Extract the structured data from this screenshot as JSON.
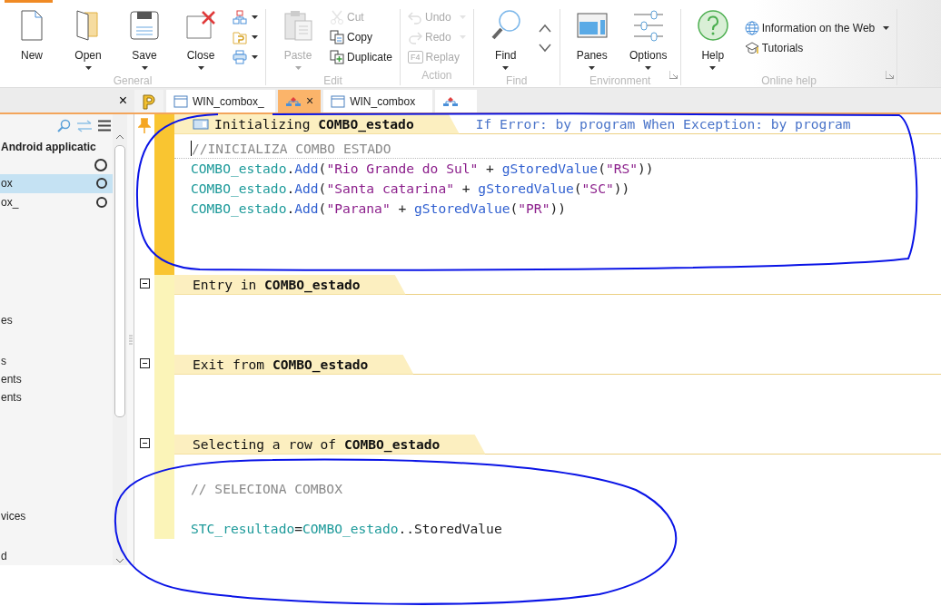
{
  "ribbon": {
    "groups": [
      {
        "label": "General",
        "launcher": false,
        "columns": [
          {
            "kind": "large",
            "buttons": [
              {
                "label": "New",
                "dropdown": false,
                "disabled": false
              }
            ]
          },
          {
            "kind": "large",
            "buttons": [
              {
                "label": "Open",
                "dropdown": true,
                "disabled": false
              }
            ]
          },
          {
            "kind": "large",
            "buttons": [
              {
                "label": "Save",
                "dropdown": true,
                "disabled": false
              }
            ]
          },
          {
            "kind": "large",
            "buttons": [
              {
                "label": "Close",
                "dropdown": true,
                "disabled": false
              }
            ]
          },
          {
            "kind": "stack",
            "buttons": [
              {
                "dropdown": true,
                "disabled": false
              },
              {
                "dropdown": true,
                "disabled": false
              },
              {
                "dropdown": true,
                "disabled": false
              }
            ]
          }
        ]
      },
      {
        "label": "Edit",
        "launcher": false,
        "columns": [
          {
            "kind": "large",
            "buttons": [
              {
                "label": "Paste",
                "dropdown": true,
                "disabled": true
              }
            ]
          },
          {
            "kind": "stack",
            "buttons": [
              {
                "label": "Cut",
                "dropdown": false,
                "disabled": true
              },
              {
                "label": "Copy",
                "dropdown": false,
                "disabled": false
              },
              {
                "label": "Duplicate",
                "dropdown": false,
                "disabled": false
              }
            ]
          }
        ]
      },
      {
        "label": "Action",
        "launcher": false,
        "columns": [
          {
            "kind": "stack",
            "buttons": [
              {
                "label": "Undo",
                "dropdown": true,
                "disabled": true
              },
              {
                "label": "Redo",
                "dropdown": true,
                "disabled": true
              },
              {
                "label": "Replay",
                "key": "F4",
                "dropdown": false,
                "disabled": true
              }
            ]
          }
        ]
      },
      {
        "label": "Find",
        "launcher": false,
        "columns": [
          {
            "kind": "large",
            "buttons": [
              {
                "label": "Find",
                "dropdown": true,
                "disabled": false
              }
            ]
          },
          {
            "kind": "stack",
            "buttons": [
              {
                "dropdown": false,
                "disabled": false
              },
              {
                "dropdown": false,
                "disabled": false
              }
            ]
          }
        ]
      },
      {
        "label": "Environment",
        "launcher": true,
        "columns": [
          {
            "kind": "large",
            "buttons": [
              {
                "label": "Panes",
                "dropdown": true,
                "disabled": false
              }
            ]
          },
          {
            "kind": "large",
            "buttons": [
              {
                "label": "Options",
                "dropdown": true,
                "disabled": false
              }
            ]
          }
        ]
      },
      {
        "label": "Online help",
        "launcher": true,
        "columns": [
          {
            "kind": "large",
            "buttons": [
              {
                "label": "Help",
                "dropdown": true,
                "disabled": false
              }
            ]
          },
          {
            "kind": "stack",
            "buttons": [
              {
                "label": "Information on the Web",
                "dropdown": true,
                "disabled": false
              },
              {
                "label": "Tutorials",
                "dropdown": false,
                "disabled": false
              }
            ]
          }
        ]
      }
    ]
  },
  "left_panel": {
    "close": "×",
    "items": [
      {
        "kind": "heading",
        "label": "Android applicatic",
        "selected": false
      },
      {
        "kind": "entry",
        "selected": false,
        "ring": true
      },
      {
        "kind": "entry",
        "label": "ox",
        "selected": true,
        "ring": true
      },
      {
        "kind": "entry",
        "label": "ox_",
        "selected": false,
        "ring": true
      },
      {
        "kind": "spacer"
      },
      {
        "kind": "entry",
        "label": "es",
        "selected": false,
        "ring": false
      },
      {
        "kind": "gap"
      },
      {
        "kind": "entry",
        "label": "s",
        "selected": false,
        "ring": false
      },
      {
        "kind": "entry",
        "label": "ents",
        "selected": false,
        "ring": false
      },
      {
        "kind": "entry",
        "label": "ents",
        "selected": false,
        "ring": false
      },
      {
        "kind": "spacer"
      },
      {
        "kind": "entry",
        "label": "vices",
        "selected": false,
        "ring": false
      },
      {
        "kind": "gap"
      },
      {
        "kind": "entry",
        "label": "d",
        "selected": false,
        "ring": false
      }
    ]
  },
  "tabs": [
    {
      "kind": "project",
      "selected": false
    },
    {
      "kind": "window",
      "label": "WIN_combox_",
      "selected": false
    },
    {
      "kind": "code",
      "selected": true,
      "close": "×"
    },
    {
      "kind": "window",
      "label": "WIN_combox",
      "selected": false
    },
    {
      "kind": "code",
      "selected": false
    }
  ],
  "sections": [
    {
      "title": "Initializing **COMBO_estado**",
      "note": "If Error: by program When Exception: by program",
      "active": true,
      "lines": [
        {
          "kind": "code",
          "cursor": true,
          "tokens": [
            {
              "kind": "comment",
              "text": "//INICIALIZA COMBO ESTADO"
            }
          ]
        },
        {
          "kind": "code",
          "cursor": false,
          "tokens": [
            {
              "kind": "ident",
              "text": "COMBO_estado"
            },
            {
              "kind": "plain",
              "text": "."
            },
            {
              "kind": "func",
              "text": "Add"
            },
            {
              "kind": "plain",
              "text": "("
            },
            {
              "kind": "string",
              "text": "\"Rio Grande do Sul\""
            },
            {
              "kind": "plain",
              "text": " + "
            },
            {
              "kind": "func",
              "text": "gStoredValue"
            },
            {
              "kind": "plain",
              "text": "("
            },
            {
              "kind": "string",
              "text": "\"RS\""
            },
            {
              "kind": "plain",
              "text": "))"
            }
          ]
        },
        {
          "kind": "code",
          "cursor": false,
          "tokens": [
            {
              "kind": "ident",
              "text": "COMBO_estado"
            },
            {
              "kind": "plain",
              "text": "."
            },
            {
              "kind": "func",
              "text": "Add"
            },
            {
              "kind": "plain",
              "text": "("
            },
            {
              "kind": "string",
              "text": "\"Santa catarina\""
            },
            {
              "kind": "plain",
              "text": " + "
            },
            {
              "kind": "func",
              "text": "gStoredValue"
            },
            {
              "kind": "plain",
              "text": "("
            },
            {
              "kind": "string",
              "text": "\"SC\""
            },
            {
              "kind": "plain",
              "text": "))"
            }
          ]
        },
        {
          "kind": "code",
          "cursor": false,
          "tokens": [
            {
              "kind": "ident",
              "text": "COMBO_estado"
            },
            {
              "kind": "plain",
              "text": "."
            },
            {
              "kind": "func",
              "text": "Add"
            },
            {
              "kind": "plain",
              "text": "("
            },
            {
              "kind": "string",
              "text": "\"Parana\""
            },
            {
              "kind": "plain",
              "text": " + "
            },
            {
              "kind": "func",
              "text": "gStoredValue"
            },
            {
              "kind": "plain",
              "text": "("
            },
            {
              "kind": "string",
              "text": "\"PR\""
            },
            {
              "kind": "plain",
              "text": "))"
            }
          ]
        }
      ]
    },
    {
      "title": "Entry in **COMBO_estado**",
      "active": false
    },
    {
      "title": "Exit from **COMBO_estado**",
      "active": false
    },
    {
      "title": "Selecting a row of **COMBO_estado**",
      "active": false,
      "lines": [
        {
          "kind": "blank"
        },
        {
          "kind": "code",
          "cursor": false,
          "tokens": [
            {
              "kind": "comment",
              "text": "// SELECIONA COMBOX"
            }
          ]
        },
        {
          "kind": "blank"
        },
        {
          "kind": "code",
          "cursor": false,
          "tokens": [
            {
              "kind": "ident",
              "text": "STC_resultado"
            },
            {
              "kind": "plain",
              "text": "="
            },
            {
              "kind": "ident",
              "text": "COMBO_estado"
            },
            {
              "kind": "plain",
              "text": "..StoredValue"
            }
          ]
        }
      ]
    }
  ]
}
